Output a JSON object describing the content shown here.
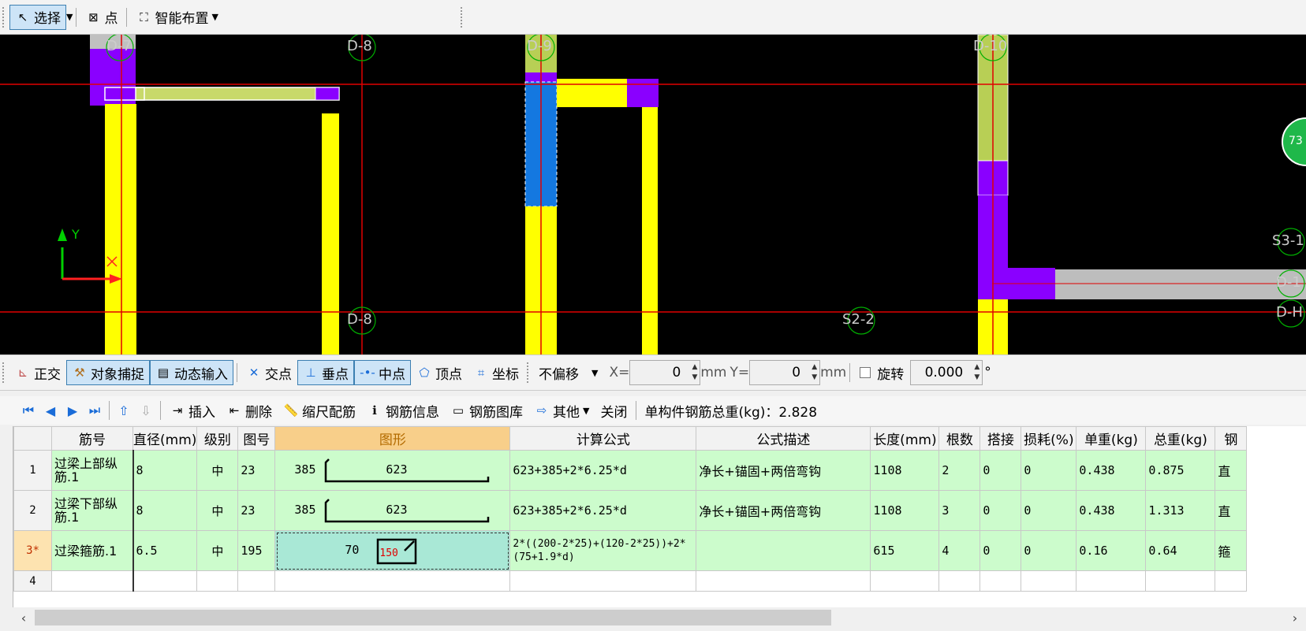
{
  "top_toolbar": {
    "select_label": "选择",
    "point_label": "点",
    "smart_layout_label": "智能布置"
  },
  "canvas": {
    "axis_y_label": "Y",
    "axis_x_label": "X",
    "grid_labels": [
      "D-7",
      "D-8",
      "D-9",
      "D-10",
      "D-8",
      "S2-2",
      "S3-1",
      "D-1",
      "D-H"
    ],
    "badge_text": "73"
  },
  "snap_toolbar": {
    "ortho_label": "正交",
    "snap_label": "对象捕捉",
    "dynamic_label": "动态输入",
    "intersect_label": "交点",
    "perp_label": "垂点",
    "mid_label": "中点",
    "vertex_label": "顶点",
    "coord_label": "坐标",
    "offset_label": "不偏移",
    "x_label": "X=",
    "x_value": "0",
    "y_label": "Y=",
    "y_value": "0",
    "unit_mm": "mm",
    "rotate_label": "旋转",
    "rotate_value": "0.000",
    "degree": "°"
  },
  "grid_toolbar": {
    "insert_label": "插入",
    "delete_label": "删除",
    "scale_label": "缩尺配筋",
    "info_label": "钢筋信息",
    "library_label": "钢筋图库",
    "other_label": "其他",
    "close_label": "关闭",
    "total_label": "单构件钢筋总重(kg)：2.828"
  },
  "table": {
    "headers": [
      "筋号",
      "直径(mm)",
      "级别",
      "图号",
      "图形",
      "计算公式",
      "公式描述",
      "长度(mm)",
      "根数",
      "搭接",
      "损耗(%)",
      "单重(kg)",
      "总重(kg)",
      "钢"
    ],
    "rows": [
      {
        "num": "1",
        "name": "过梁上部纵筋.1",
        "dia": "8",
        "grade": "中",
        "fig": "23",
        "shape_a": "385",
        "shape_b": "623",
        "formula": "623+385+2*6.25*d",
        "desc": "净长+锚固+两倍弯钩",
        "length": "1108",
        "count": "2",
        "lap": "0",
        "loss": "0",
        "unit_w": "0.438",
        "total_w": "0.875",
        "extra": "直"
      },
      {
        "num": "2",
        "name": "过梁下部纵筋.1",
        "dia": "8",
        "grade": "中",
        "fig": "23",
        "shape_a": "385",
        "shape_b": "623",
        "formula": "623+385+2*6.25*d",
        "desc": "净长+锚固+两倍弯钩",
        "length": "1108",
        "count": "3",
        "lap": "0",
        "loss": "0",
        "unit_w": "0.438",
        "total_w": "1.313",
        "extra": "直"
      },
      {
        "num": "3*",
        "name": "过梁箍筋.1",
        "dia": "6.5",
        "grade": "中",
        "fig": "195",
        "shape_a": "70",
        "shape_b": "150",
        "formula": "2*((200-2*25)+(120-2*25))+2*(75+1.9*d)",
        "desc": "",
        "length": "615",
        "count": "4",
        "lap": "0",
        "loss": "0",
        "unit_w": "0.16",
        "total_w": "0.64",
        "extra": "箍"
      },
      {
        "num": "4"
      }
    ]
  },
  "colors": {
    "accent": "#1a6cd8",
    "selected_header": "#f8cf8a",
    "row_bg": "#ccfccc",
    "canvas_bg": "#000000"
  }
}
